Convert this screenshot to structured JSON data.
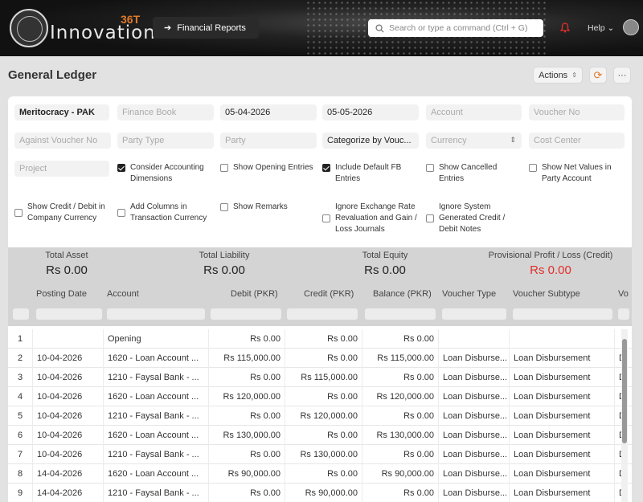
{
  "navbar": {
    "logo_text": "Innovation",
    "logo_sup": "36T",
    "breadcrumb": "Financial Reports",
    "search_placeholder": "Search or type a command (Ctrl + G)",
    "help_label": "Help"
  },
  "page": {
    "title": "General Ledger",
    "actions_label": "Actions"
  },
  "filters": {
    "company": "Meritocracy - PAK",
    "finance_book": "Finance Book",
    "from_date": "05-04-2026",
    "to_date": "05-05-2026",
    "account": "Account",
    "voucher_no": "Voucher No",
    "against_voucher_no": "Against Voucher No",
    "party_type": "Party Type",
    "party": "Party",
    "group_by": "Categorize by Vouc...",
    "currency": "Currency",
    "cost_center": "Cost Center",
    "project": "Project"
  },
  "checkboxes": {
    "accounting_dimensions": {
      "label": "Consider Accounting Dimensions",
      "checked": true
    },
    "opening_entries": {
      "label": "Show Opening Entries",
      "checked": false
    },
    "default_fb": {
      "label": "Include Default FB Entries",
      "checked": true
    },
    "cancelled": {
      "label": "Show Cancelled Entries",
      "checked": false
    },
    "net_values": {
      "label": "Show Net Values in Party Account",
      "checked": false
    },
    "credit_debit": {
      "label": "Show Credit / Debit in Company Currency",
      "checked": false
    },
    "transaction_currency": {
      "label": "Add Columns in Transaction Currency",
      "checked": false
    },
    "remarks": {
      "label": "Show Remarks",
      "checked": false
    },
    "exchange_rate": {
      "label": "Ignore Exchange Rate Revaluation and Gain / Loss Journals",
      "checked": false
    },
    "system_generated": {
      "label": "Ignore System Generated Credit / Debit Notes",
      "checked": false
    }
  },
  "summary": {
    "total_asset": {
      "label": "Total Asset",
      "value": "Rs 0.00"
    },
    "total_liability": {
      "label": "Total Liability",
      "value": "Rs 0.00"
    },
    "total_equity": {
      "label": "Total Equity",
      "value": "Rs 0.00"
    },
    "profit_loss": {
      "label": "Provisional Profit / Loss (Credit)",
      "value": "Rs 0.00",
      "color": "#e0302a"
    }
  },
  "table": {
    "columns": [
      "Posting Date",
      "Account",
      "Debit (PKR)",
      "Credit (PKR)",
      "Balance (PKR)",
      "Voucher Type",
      "Voucher Subtype",
      "Vo"
    ],
    "rows": [
      [
        "1",
        "",
        "Opening",
        "Rs 0.00",
        "Rs 0.00",
        "Rs 0.00",
        "",
        "",
        ""
      ],
      [
        "2",
        "10-04-2026",
        "1620 - Loan Account ...",
        "Rs 115,000.00",
        "Rs 0.00",
        "Rs 115,000.00",
        "Loan Disburse...",
        "Loan Disbursement",
        "D"
      ],
      [
        "3",
        "10-04-2026",
        "1210 - Faysal Bank - ...",
        "Rs 0.00",
        "Rs 115,000.00",
        "Rs 0.00",
        "Loan Disburse...",
        "Loan Disbursement",
        "D"
      ],
      [
        "4",
        "10-04-2026",
        "1620 - Loan Account ...",
        "Rs 120,000.00",
        "Rs 0.00",
        "Rs 120,000.00",
        "Loan Disburse...",
        "Loan Disbursement",
        "D"
      ],
      [
        "5",
        "10-04-2026",
        "1210 - Faysal Bank - ...",
        "Rs 0.00",
        "Rs 120,000.00",
        "Rs 0.00",
        "Loan Disburse...",
        "Loan Disbursement",
        "D"
      ],
      [
        "6",
        "10-04-2026",
        "1620 - Loan Account ...",
        "Rs 130,000.00",
        "Rs 0.00",
        "Rs 130,000.00",
        "Loan Disburse...",
        "Loan Disbursement",
        "D"
      ],
      [
        "7",
        "10-04-2026",
        "1210 - Faysal Bank - ...",
        "Rs 0.00",
        "Rs 130,000.00",
        "Rs 0.00",
        "Loan Disburse...",
        "Loan Disbursement",
        "D"
      ],
      [
        "8",
        "14-04-2026",
        "1620 - Loan Account ...",
        "Rs 90,000.00",
        "Rs 0.00",
        "Rs 90,000.00",
        "Loan Disburse...",
        "Loan Disbursement",
        "D"
      ],
      [
        "9",
        "14-04-2026",
        "1210 - Faysal Bank - ...",
        "Rs 0.00",
        "Rs 90,000.00",
        "Rs 0.00",
        "Loan Disburse...",
        "Loan Disbursement",
        "D"
      ]
    ]
  },
  "colors": {
    "accent": "#e07a2a",
    "loss_red": "#e0302a",
    "nav_bg": "#1c1c1c"
  }
}
